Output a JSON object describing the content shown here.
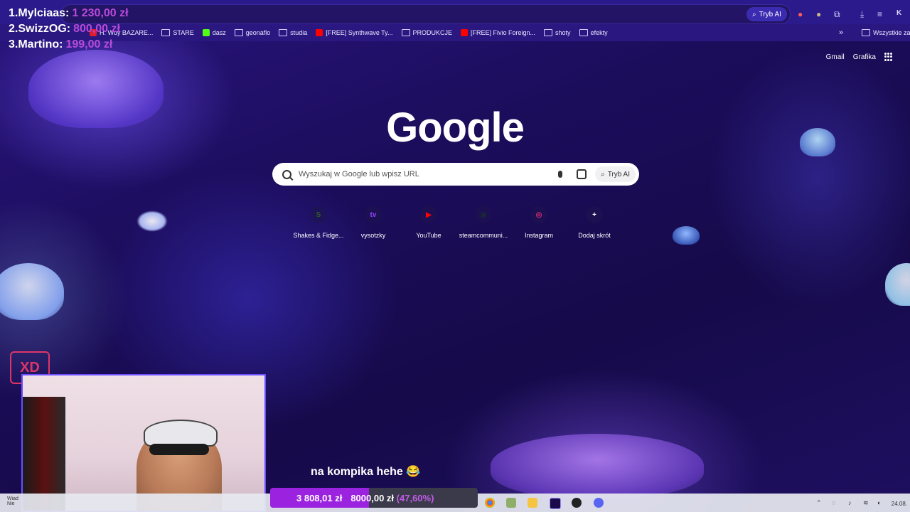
{
  "leaderboard": [
    {
      "rank_name": "1.Mylciaas:",
      "amount": "1 230,00 zł"
    },
    {
      "rank_name": "2.SwizzOG:",
      "amount": "800,00 zł"
    },
    {
      "rank_name": "3.Martino:",
      "amount": "199,00 zł"
    }
  ],
  "browser": {
    "tryb_ai": "Tryb AI",
    "profile_initial": "K"
  },
  "bookmarks": [
    {
      "label": "H: Wuy BAZARE...",
      "icon": "bookmark-icon",
      "color": "#e21b2b"
    },
    {
      "label": "STARE",
      "icon": "folder-icon",
      "color": ""
    },
    {
      "label": "dasz",
      "icon": "kick-icon",
      "color": "#53fc18"
    },
    {
      "label": "geonaflo",
      "icon": "folder-icon",
      "color": ""
    },
    {
      "label": "studia",
      "icon": "folder-icon",
      "color": ""
    },
    {
      "label": "[FREE] Synthwave Ty...",
      "icon": "youtube-icon",
      "color": "#ff0000"
    },
    {
      "label": "PRODUKCJE",
      "icon": "folder-icon",
      "color": ""
    },
    {
      "label": "[FREE] Fivio Foreign...",
      "icon": "youtube-icon",
      "color": "#ff0000"
    },
    {
      "label": "shoty",
      "icon": "folder-icon",
      "color": ""
    },
    {
      "label": "efekty",
      "icon": "folder-icon",
      "color": ""
    }
  ],
  "bookmarks_more": "»",
  "bookmarks_all": "Wszystkie zak",
  "top_links": {
    "gmail": "Gmail",
    "grafika": "Grafika"
  },
  "google": {
    "logo": "Google",
    "search_placeholder": "Wyszukaj w Google lub wpisz URL",
    "ai_button": "Tryb AI"
  },
  "shortcuts": [
    {
      "label": "Shakes & Fidge...",
      "icon": "S",
      "color": "#2e5b2a"
    },
    {
      "label": "vysotzky",
      "icon": "tv",
      "color": "#9146ff"
    },
    {
      "label": "YouTube",
      "icon": "▶",
      "color": "#ff0000"
    },
    {
      "label": "steamcommuni...",
      "icon": "◉",
      "color": "#1b2838"
    },
    {
      "label": "Instagram",
      "icon": "◎",
      "color": "#d62976"
    },
    {
      "label": "Dodaj skrót",
      "icon": "+",
      "color": ""
    }
  ],
  "caption": "na kompika hehe 😂",
  "donation": {
    "current": "3 808,01 zł",
    "goal": "8000,00 zł",
    "percent_label": "(47,60%)",
    "fraction": 0.476
  },
  "overlay_badge": "XD",
  "taskbar": {
    "widget_text": "Wiad Nie",
    "clock": "24.08."
  }
}
